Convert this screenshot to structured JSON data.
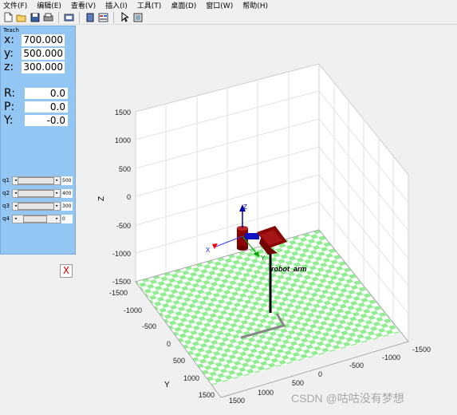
{
  "menu": [
    "文件(F)",
    "编辑(E)",
    "查看(V)",
    "插入(I)",
    "工具(T)",
    "桌面(D)",
    "窗口(W)",
    "帮助(H)"
  ],
  "toolbar": [
    "new-file-icon",
    "open-file-icon",
    "save-icon",
    "print-icon",
    "print-preview-icon",
    "panel-icon",
    "property-inspector-icon",
    "pointer-icon",
    "docked-figure-icon"
  ],
  "teach": {
    "title": "Teach",
    "position": [
      {
        "label": "x:",
        "value": "700.000"
      },
      {
        "label": "y:",
        "value": "500.000"
      },
      {
        "label": "z:",
        "value": "300.000"
      }
    ],
    "orientation": [
      {
        "label": "R:",
        "value": "0.0"
      },
      {
        "label": "P:",
        "value": "0.0"
      },
      {
        "label": "Y:",
        "value": "-0.0"
      }
    ],
    "joints": [
      {
        "label": "q1",
        "value": "500",
        "fraction": 0.8
      },
      {
        "label": "q2",
        "value": "400",
        "fraction": 0.8
      },
      {
        "label": "q3",
        "value": "300",
        "fraction": 0.8
      },
      {
        "label": "q4",
        "value": "0",
        "fraction": 0.5
      }
    ],
    "close_label": "X"
  },
  "plot": {
    "z_axis_label": "Z",
    "y_axis_label": "Y",
    "z_ticks": [
      "1500",
      "1000",
      "500",
      "0",
      "-500",
      "-1000",
      "-1500"
    ],
    "y_ticks": [
      "-1500",
      "-1000",
      "-500",
      "0",
      "500",
      "1000",
      "1500"
    ],
    "x_ticks": [
      "1500",
      "1000",
      "500",
      "0",
      "-500",
      "-1000",
      "-1500"
    ],
    "robot_label": "robot_arm",
    "frame_labels": {
      "x": "X",
      "y": "Y",
      "z": "Z"
    },
    "floor_colors": [
      "#90ee90",
      "#ffffff"
    ]
  },
  "watermark": "CSDN @咕咕没有梦想"
}
